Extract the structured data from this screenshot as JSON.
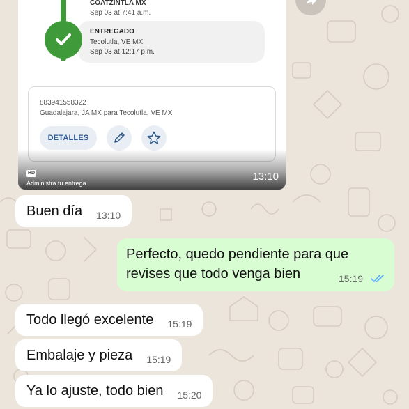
{
  "tracking": {
    "prev_step": {
      "title": "COATZINTLA MX",
      "date": "Sep 03 at 7:41 a.m."
    },
    "current_step": {
      "status": "ENTREGADO",
      "location": "Tecolutla, VE MX",
      "date": "Sep 03 at 12:17 p.m."
    },
    "package": {
      "number": "883941558322",
      "route": "Guadalajara, JA MX para Tecolutla, VE MX",
      "details_label": "DETALLES"
    },
    "hd_label": "HD",
    "caption": "Administra tu entrega",
    "time": "13:10"
  },
  "messages": [
    {
      "text": "Buen día",
      "time": "13:10"
    },
    {
      "line1": "Perfecto, quedo pendiente para que",
      "line2": "revises que todo venga bien",
      "time": "15:19"
    },
    {
      "text": "Todo llegó excelente",
      "time": "15:19"
    },
    {
      "text": "Embalaje y pieza",
      "time": "15:19"
    },
    {
      "text": "Ya lo ajuste, todo bien",
      "time": "15:20"
    }
  ],
  "colors": {
    "wallpaper": "#ece5dc",
    "outgoing_bubble": "#d9fdd3",
    "incoming_bubble": "#ffffff",
    "delivered_green": "#3f9a3a",
    "read_ticks": "#53a6fd"
  }
}
